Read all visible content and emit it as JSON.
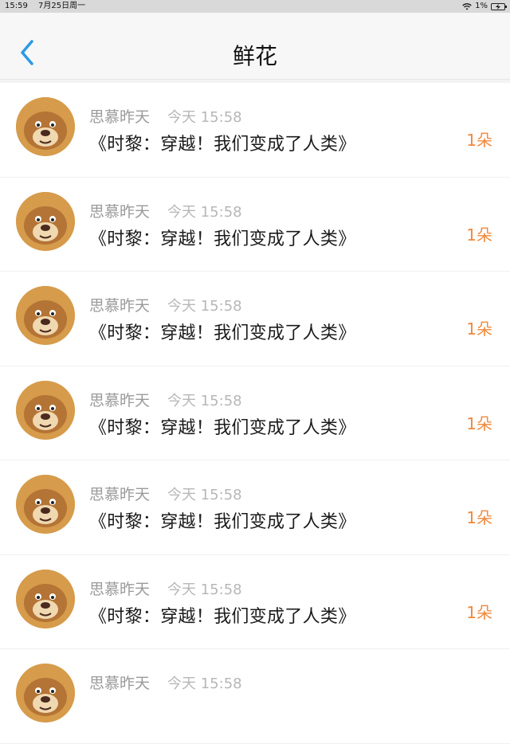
{
  "status_bar": {
    "time": "15:59",
    "date": "7月25日周一",
    "battery": "1%"
  },
  "nav": {
    "title": "鲜花"
  },
  "colors": {
    "accent_back": "#2c9ae6",
    "count": "#f0893c"
  },
  "rows": [
    {
      "name": "思慕昨天",
      "time": "今天 15:58",
      "title": "《时黎：穿越！我们变成了人类》",
      "count": "1朵"
    },
    {
      "name": "思慕昨天",
      "time": "今天 15:58",
      "title": "《时黎：穿越！我们变成了人类》",
      "count": "1朵"
    },
    {
      "name": "思慕昨天",
      "time": "今天 15:58",
      "title": "《时黎：穿越！我们变成了人类》",
      "count": "1朵"
    },
    {
      "name": "思慕昨天",
      "time": "今天 15:58",
      "title": "《时黎：穿越！我们变成了人类》",
      "count": "1朵"
    },
    {
      "name": "思慕昨天",
      "time": "今天 15:58",
      "title": "《时黎：穿越！我们变成了人类》",
      "count": "1朵"
    },
    {
      "name": "思慕昨天",
      "time": "今天 15:58",
      "title": "《时黎：穿越！我们变成了人类》",
      "count": "1朵"
    },
    {
      "name": "思慕昨天",
      "time": "今天 15:58",
      "title": "",
      "count": ""
    }
  ]
}
